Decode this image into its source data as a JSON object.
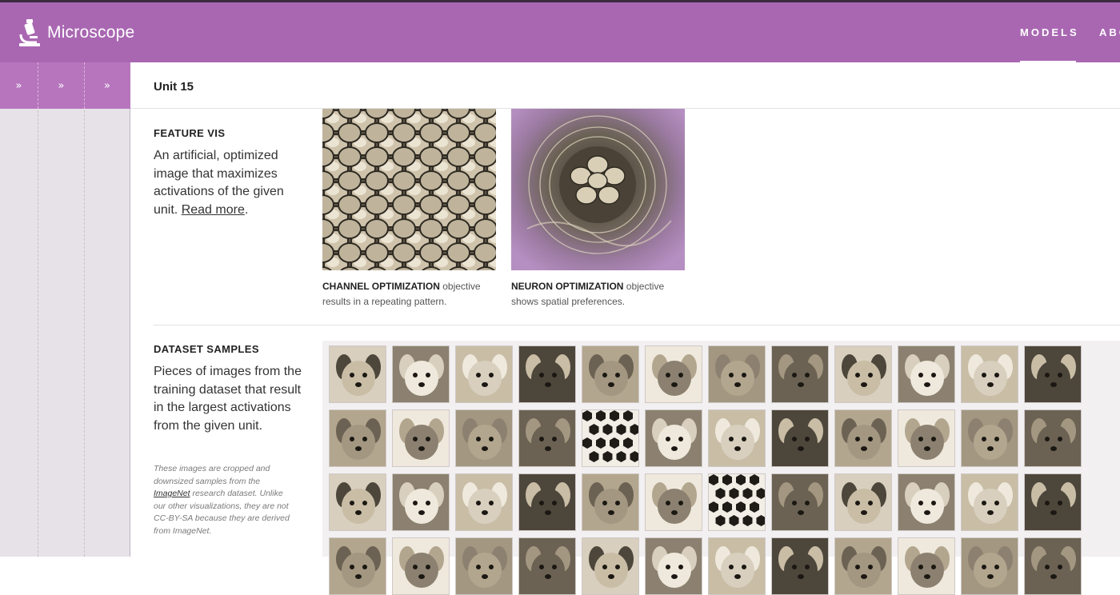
{
  "header": {
    "brand": "Microscope",
    "nav": {
      "models": "MODELS",
      "about": "ABO"
    },
    "logo_icon": "microscope-icon"
  },
  "sidebar": {
    "expand_labels": [
      "»",
      "»",
      "»"
    ]
  },
  "main": {
    "unit_title": "Unit 15",
    "feature_vis": {
      "title": "FEATURE VIS",
      "description": "An artificial, optimized image that maximizes activations of the given unit.",
      "link": "Read more",
      "trailing": ".",
      "images": [
        {
          "caption_bold": "CHANNEL OPTIMIZATION",
          "caption_rest": " objective results in a repeating pattern."
        },
        {
          "caption_bold": "NEURON OPTIMIZATION",
          "caption_rest": " objective shows spatial preferences."
        }
      ]
    },
    "dataset_samples": {
      "title": "DATASET SAMPLES",
      "description": "Pieces of images from the training dataset that result in the largest activations from the given unit.",
      "note_before": "These images are cropped and downsized samples from the ",
      "note_link": "ImageNet",
      "note_after": " research dataset. Unlike our other visualizations, they are not CC-BY-SA because they are derived from ImageNet."
    }
  },
  "colors": {
    "header": "#a967b2",
    "sidebar_strip": "#b775bd",
    "sidebar": "#e6e2e8"
  }
}
